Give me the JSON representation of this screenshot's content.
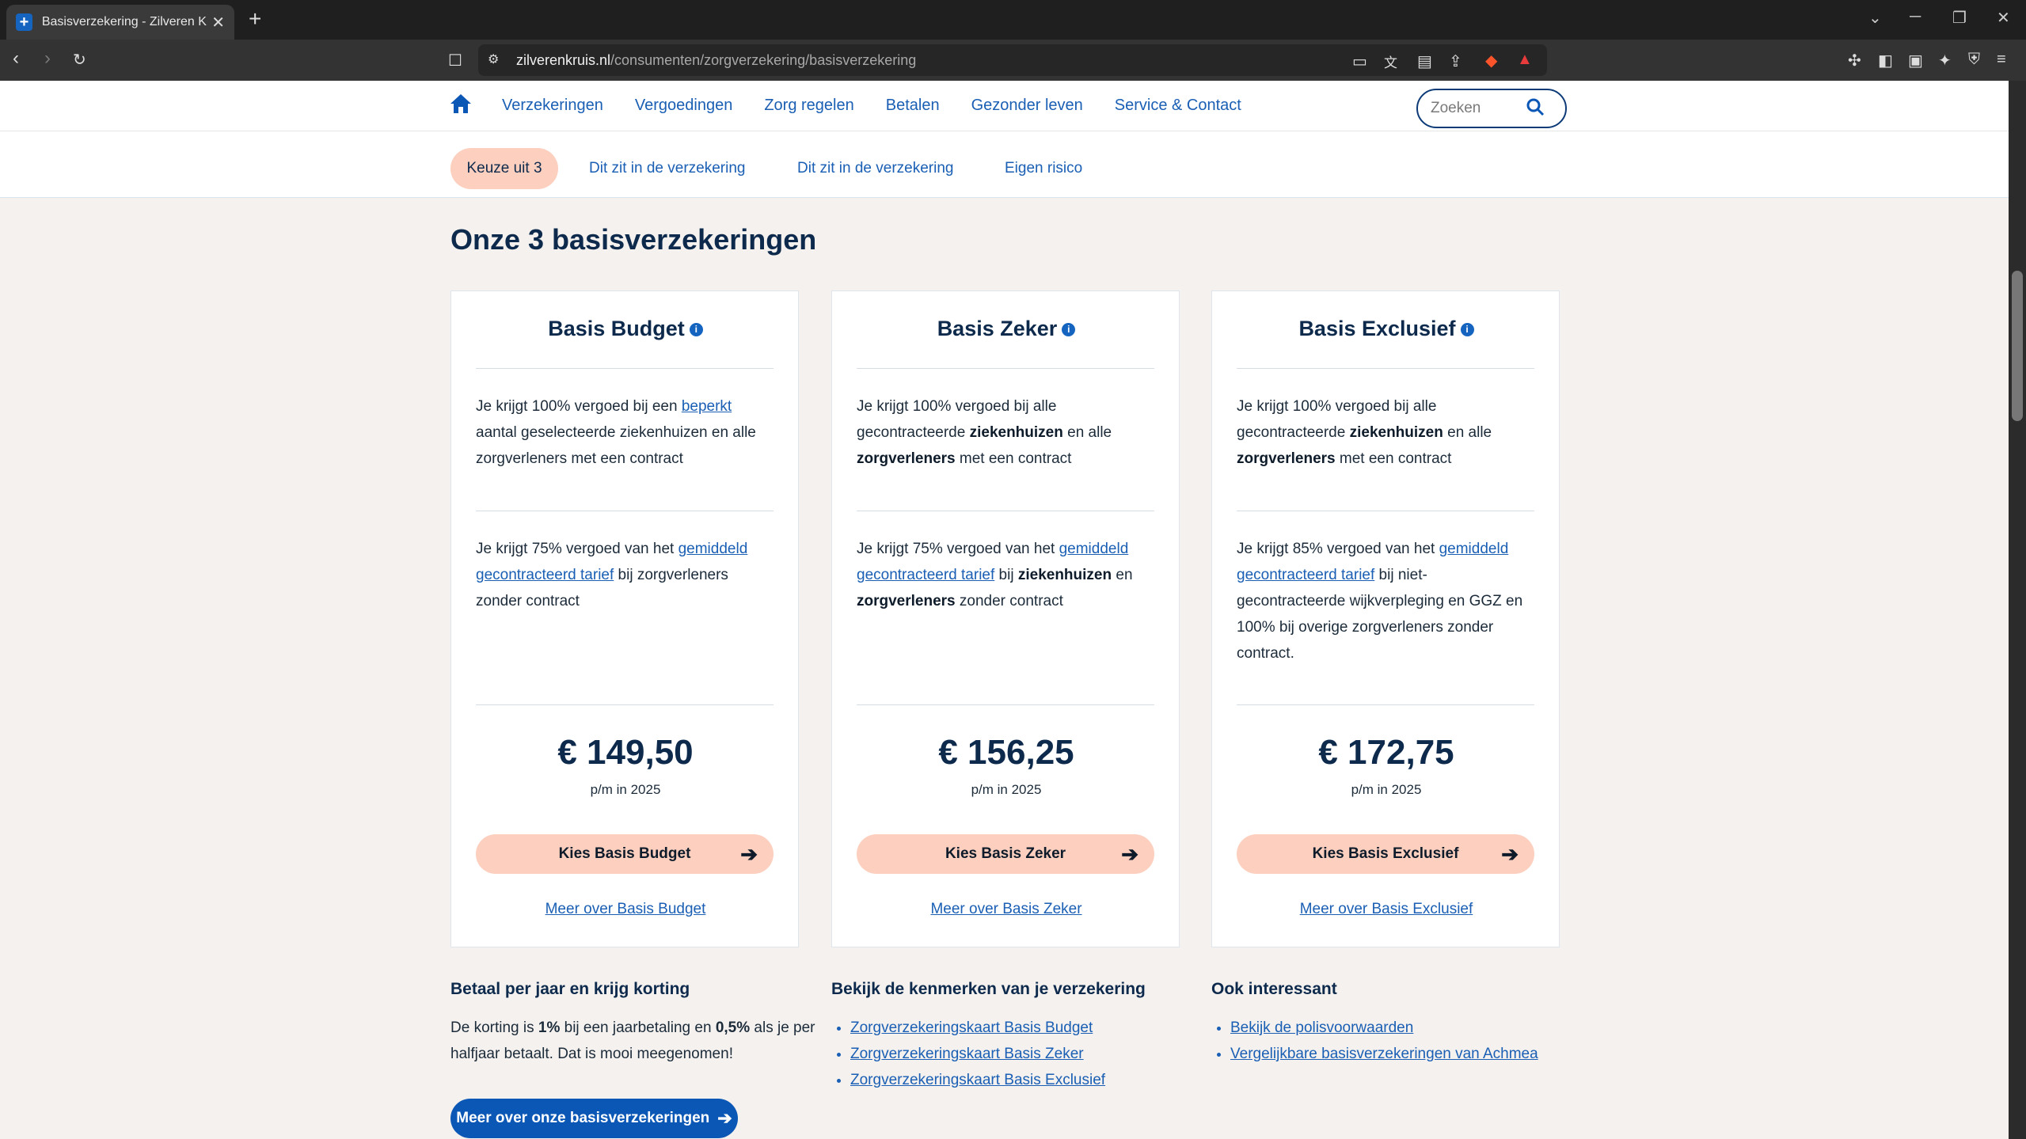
{
  "browser": {
    "tab_title": "Basisverzekering - Zilveren Kruis",
    "url_domain": "zilverenkruis.nl",
    "url_path": "/consumenten/zorgverzekering/basisverzekering"
  },
  "nav": {
    "links": [
      "Verzekeringen",
      "Vergoedingen",
      "Zorg regelen",
      "Betalen",
      "Gezonder leven",
      "Service & Contact"
    ],
    "search_placeholder": "Zoeken"
  },
  "subnav": {
    "active": "Keuze uit 3",
    "links": [
      "Dit zit in de verzekering",
      "Dit zit in de verzekering",
      "Eigen risico"
    ]
  },
  "page_title": "Onze 3 basisverzekeringen",
  "cards": [
    {
      "title": "Basis Budget",
      "block1": {
        "pre": "Je krijgt 100% vergoed bij een ",
        "link": "beperkt",
        "post": " aantal geselecteerde ziekenhuizen en alle zorgverleners met een contract"
      },
      "block2": {
        "pre": "Je krijgt 75% vergoed van het ",
        "link": "gemiddeld gecontracteerd tarief",
        "post": " bij zorgverleners zonder contract"
      },
      "price": "€ 149,50",
      "price_sub": "p/m in 2025",
      "cta": "Kies Basis Budget",
      "more": "Meer over Basis Budget"
    },
    {
      "title": "Basis Zeker",
      "block1": {
        "pre": "Je krijgt 100% vergoed bij alle gecontracteerde ",
        "b1": "ziekenhuizen",
        "mid": " en alle ",
        "b2": "zorgverleners",
        "post": " met een contract"
      },
      "block2": {
        "pre": "Je krijgt 75% vergoed van het ",
        "link": "gemiddeld gecontracteerd tarief",
        "mid": " bij ",
        "b1": "ziekenhuizen",
        "mid2": " en ",
        "b2": "zorgverleners",
        "post": " zonder contract"
      },
      "price": "€ 156,25",
      "price_sub": "p/m in 2025",
      "cta": "Kies Basis Zeker",
      "more": "Meer over Basis Zeker"
    },
    {
      "title": "Basis Exclusief",
      "block1": {
        "pre": "Je krijgt 100% vergoed bij alle gecontracteerde ",
        "b1": "ziekenhuizen",
        "mid": " en alle ",
        "b2": "zorgverleners",
        "post": " met een contract"
      },
      "block2": {
        "pre": "Je krijgt 85% vergoed van het ",
        "link": "gemiddeld gecontracteerd tarief",
        "post": " bij niet-gecontracteerde wijkverpleging en GGZ en 100% bij overige zorgverleners zonder contract."
      },
      "price": "€ 172,75",
      "price_sub": "p/m in 2025",
      "cta": "Kies Basis Exclusief",
      "more": "Meer over Basis Exclusief"
    }
  ],
  "bottom": {
    "col1_title": "Betaal per jaar en krijg korting",
    "col1_pre": "De korting is ",
    "col1_b1": "1%",
    "col1_mid": " bij een jaarbetaling en ",
    "col1_b2": "0,5%",
    "col1_post": " als je per halfjaar betaalt. Dat is mooi meegenomen!",
    "col2_title": "Bekijk de kenmerken van je verzekering",
    "col2_links": [
      "Zorgverzekeringskaart Basis Budget",
      "Zorgverzekeringskaart Basis Zeker",
      "Zorgverzekeringskaart Basis Exclusief"
    ],
    "col3_title": "Ook interessant",
    "col3_links": [
      "Bekijk de polisvoorwaarden",
      "Vergelijkbare basisverzekeringen van Achmea"
    ],
    "button": "Meer over onze basisverzekeringen"
  }
}
